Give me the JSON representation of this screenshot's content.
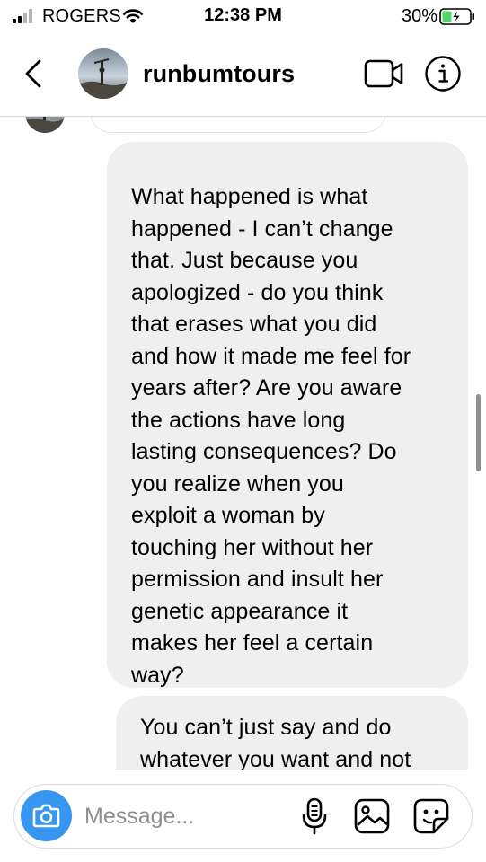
{
  "status_bar": {
    "carrier": "ROGERS",
    "time": "12:38 PM",
    "battery_percent": "30%",
    "signal_bars_filled": 2,
    "signal_bars_total": 4,
    "battery_charging": true,
    "battery_level": 0.3
  },
  "header": {
    "username": "runbumtours",
    "back_icon": "chevron-left-icon",
    "video_icon": "video-camera-icon",
    "info_icon": "info-icon"
  },
  "messages": [
    {
      "sender": "me",
      "text": "What happened is what\nhappened - I can’t change\nthat. Just because you\napologized - do you think\nthat erases what you did\nand how it made me feel for\nyears after? Are you aware\nthe actions have long\nlasting consequences? Do\nyou realize when you\nexploit a woman by\ntouching her without her\npermission and insult her\ngenetic appearance it\nmakes her feel a certain\nway?"
    },
    {
      "sender": "me",
      "text": "You can’t just say and do\nwhatever you want and not"
    }
  ],
  "composer": {
    "placeholder": "Message...",
    "value": "",
    "camera_icon": "camera-icon",
    "mic_icon": "microphone-icon",
    "gallery_icon": "image-gallery-icon",
    "sticker_icon": "sticker-icon"
  },
  "colors": {
    "bubble_background": "#efefef",
    "camera_button": "#3797f0",
    "divider": "#dbdbdb",
    "placeholder": "#8e8e8e"
  }
}
